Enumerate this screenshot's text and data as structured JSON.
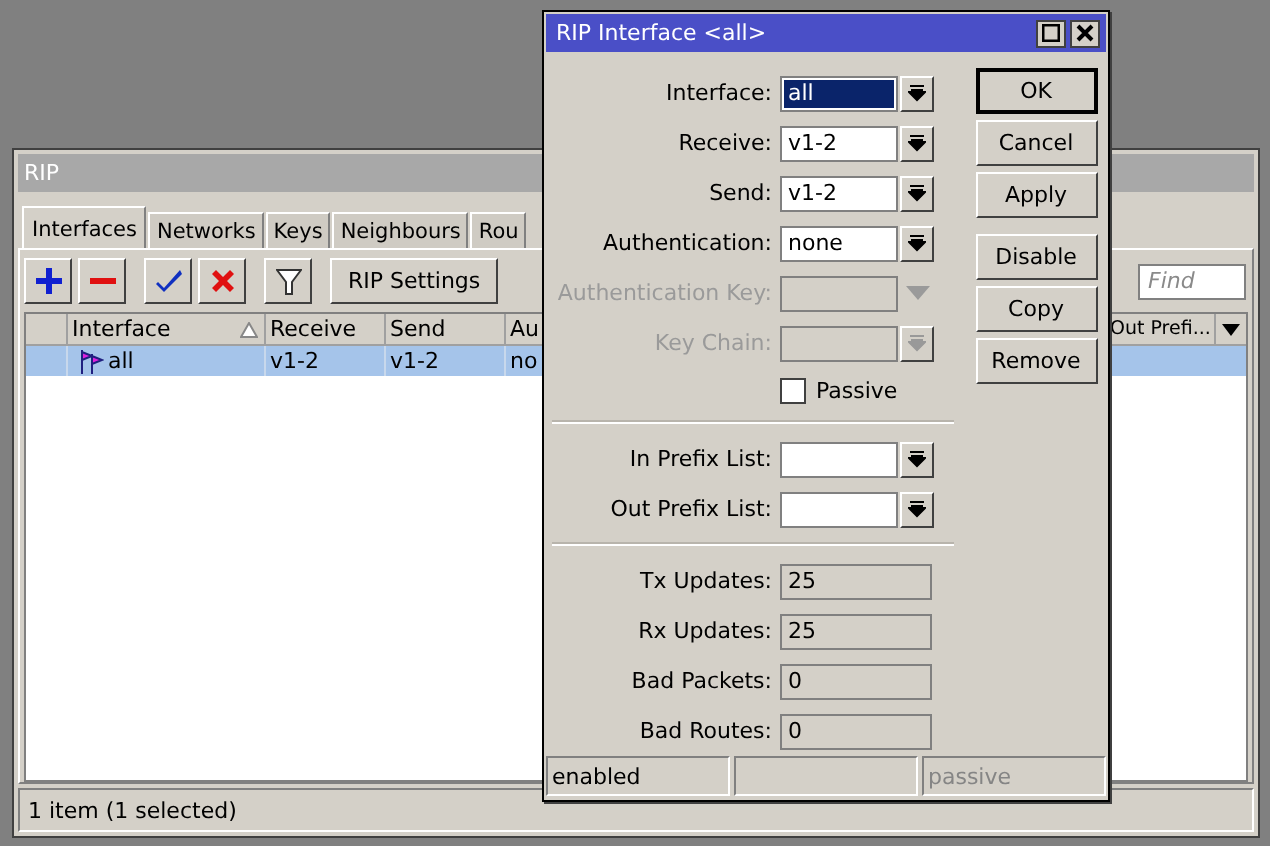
{
  "rip_window": {
    "title": "RIP",
    "tabs": [
      {
        "label": "Interfaces",
        "selected": true
      },
      {
        "label": "Networks",
        "selected": false
      },
      {
        "label": "Keys",
        "selected": false
      },
      {
        "label": "Neighbours",
        "selected": false
      },
      {
        "label": "Rou",
        "selected": false
      }
    ],
    "toolbar": {
      "settings_button": "RIP Settings",
      "find": {
        "placeholder": "Find"
      }
    },
    "table": {
      "left_columns": [
        {
          "label": "Interface",
          "sorted": true
        },
        {
          "label": "Receive",
          "sorted": false
        },
        {
          "label": "Send",
          "sorted": false
        },
        {
          "label": "Au"
        }
      ],
      "right_columns": [
        {
          "label": "Out Prefi..."
        }
      ],
      "rows": [
        {
          "selected": true,
          "cells": [
            "all",
            "v1-2",
            "v1-2",
            "no"
          ]
        }
      ]
    },
    "status_bar": "1 item (1 selected)"
  },
  "dialog": {
    "title": "RIP Interface <all>",
    "fields": [
      {
        "label": "Interface:",
        "value": "all",
        "kind": "dropdown",
        "disabled": false,
        "focused": true
      },
      {
        "label": "Receive:",
        "value": "v1-2",
        "kind": "dropdown",
        "disabled": false,
        "focused": false
      },
      {
        "label": "Send:",
        "value": "v1-2",
        "kind": "dropdown",
        "disabled": false,
        "focused": false
      },
      {
        "label": "Authentication:",
        "value": "none",
        "kind": "dropdown",
        "disabled": false,
        "focused": false
      },
      {
        "label": "Authentication Key:",
        "kind": "combo",
        "disabled": true,
        "focused": false
      },
      {
        "label": "Key Chain:",
        "kind": "dropdown",
        "disabled": true,
        "focused": false
      }
    ],
    "passive": {
      "label": "Passive",
      "checked": false
    },
    "prefix_fields": [
      {
        "label": "In Prefix List:",
        "kind": "dropdown",
        "disabled": false
      },
      {
        "label": "Out Prefix List:",
        "kind": "dropdown",
        "disabled": false
      }
    ],
    "stats": [
      {
        "label": "Tx Updates:",
        "value": "25"
      },
      {
        "label": "Rx Updates:",
        "value": "25"
      },
      {
        "label": "Bad Packets:",
        "value": "0"
      },
      {
        "label": "Bad Routes:",
        "value": "0"
      }
    ],
    "buttons_top": [
      {
        "label": "OK",
        "default": true
      },
      {
        "label": "Cancel",
        "default": false
      },
      {
        "label": "Apply",
        "default": false
      }
    ],
    "buttons_bottom": [
      {
        "label": "Disable",
        "default": false
      },
      {
        "label": "Copy",
        "default": false
      },
      {
        "label": "Remove",
        "default": false
      }
    ],
    "status_panes": [
      {
        "kind": "text",
        "text": "enabled",
        "disabled": false
      },
      {
        "kind": "empty"
      },
      {
        "kind": "text",
        "text": "passive",
        "disabled": true
      }
    ]
  }
}
